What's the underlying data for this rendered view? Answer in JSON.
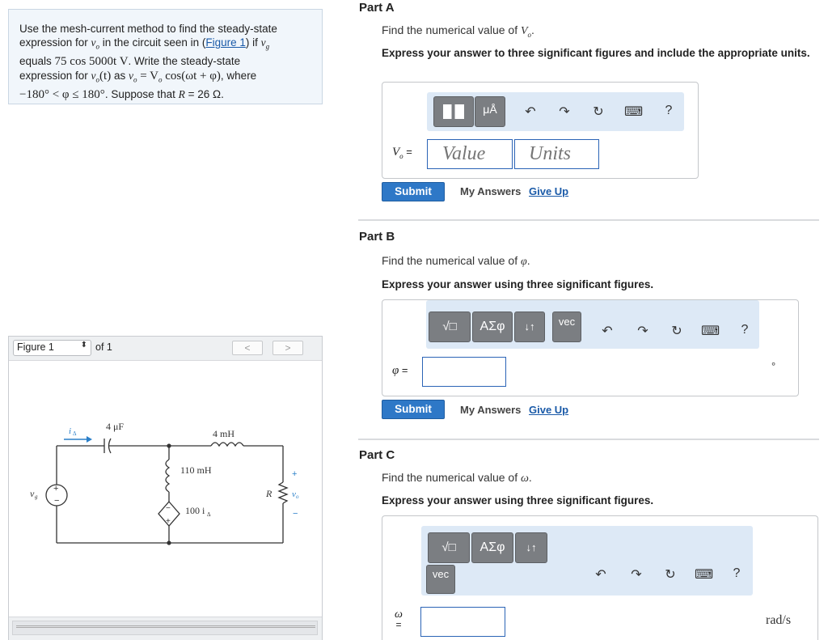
{
  "problem": {
    "line1": "Use the mesh-current method to find the steady-state",
    "line2_a": "expression for ",
    "line2_v": "v",
    "line2_vsub": "o",
    "line2_b": " in the circuit seen in (",
    "figure_link": "Figure 1",
    "line2_c": ") if ",
    "line2_vg": "v",
    "line2_vgsub": "g",
    "line3_a": "equals ",
    "line3_expr": "75 cos 5000t V",
    "line3_b": ". Write the steady-state",
    "line4_a": "expression for ",
    "line4_expr1": "v",
    "line4_expr1sub": "o",
    "line4_expr2": "(t)",
    "line4_b": " as ",
    "line4_expr3": "v",
    "line4_expr3sub": "o",
    "line4_expr4": " = V",
    "line4_expr4sub": "o",
    "line4_expr5": " cos(ωt + φ)",
    "line4_c": ", where",
    "line5_expr": "−180° < φ ≤ 180°",
    "line5_b": ". Suppose that ",
    "line5_r": "R",
    "line5_c": " = 26 Ω."
  },
  "figure": {
    "select_value": "Figure 1",
    "of_label": "of 1",
    "prev_icon": "<",
    "next_icon": ">",
    "circuit": {
      "ia": "i",
      "ia_sub": "Δ",
      "cap": "4 μF",
      "ind1": "4 mH",
      "ind2": "110 mH",
      "dep": "100 i",
      "dep_sub": "Δ",
      "vg": "v",
      "vg_sub": "g",
      "r": "R",
      "vo": "v",
      "vo_sub": "o",
      "plus": "+",
      "minus": "−"
    }
  },
  "partA": {
    "title": "Part A",
    "find_a": "Find the numerical value of ",
    "find_v": "V",
    "find_vsub": "o",
    "find_b": ".",
    "express": "Express your answer to three significant figures and include the appropriate units.",
    "tool_mu": "μÅ",
    "var_label": "V",
    "var_sub": "o",
    "eq": " =",
    "value_placeholder": "Value",
    "units_placeholder": "Units",
    "submit": "Submit",
    "my_answers": "My Answers",
    "give_up": "Give Up"
  },
  "partB": {
    "title": "Part B",
    "find_a": "Find the numerical value of ",
    "find_phi": "φ",
    "find_b": ".",
    "express": "Express your answer using three significant figures.",
    "tool_sqrt": "√□",
    "tool_greek": "ΑΣφ",
    "tool_arrows": "↓↑",
    "tool_vec": "vec",
    "var_label": "φ",
    "eq": " =",
    "unit": "°",
    "submit": "Submit",
    "my_answers": "My Answers",
    "give_up": "Give Up"
  },
  "partC": {
    "title": "Part C",
    "find_a": "Find the numerical value of ",
    "find_w": "ω",
    "find_b": ".",
    "express": "Express your answer using three significant figures.",
    "tool_sqrt": "√□",
    "tool_greek": "ΑΣφ",
    "tool_arrows": "↓↑",
    "tool_vec": "vec",
    "var_label": "ω",
    "eq": "=",
    "unit": "rad/s"
  },
  "toolbar_icons": {
    "undo": "↶",
    "redo": "↷",
    "reset": "↻",
    "keyboard": "⌨",
    "help": "?"
  }
}
